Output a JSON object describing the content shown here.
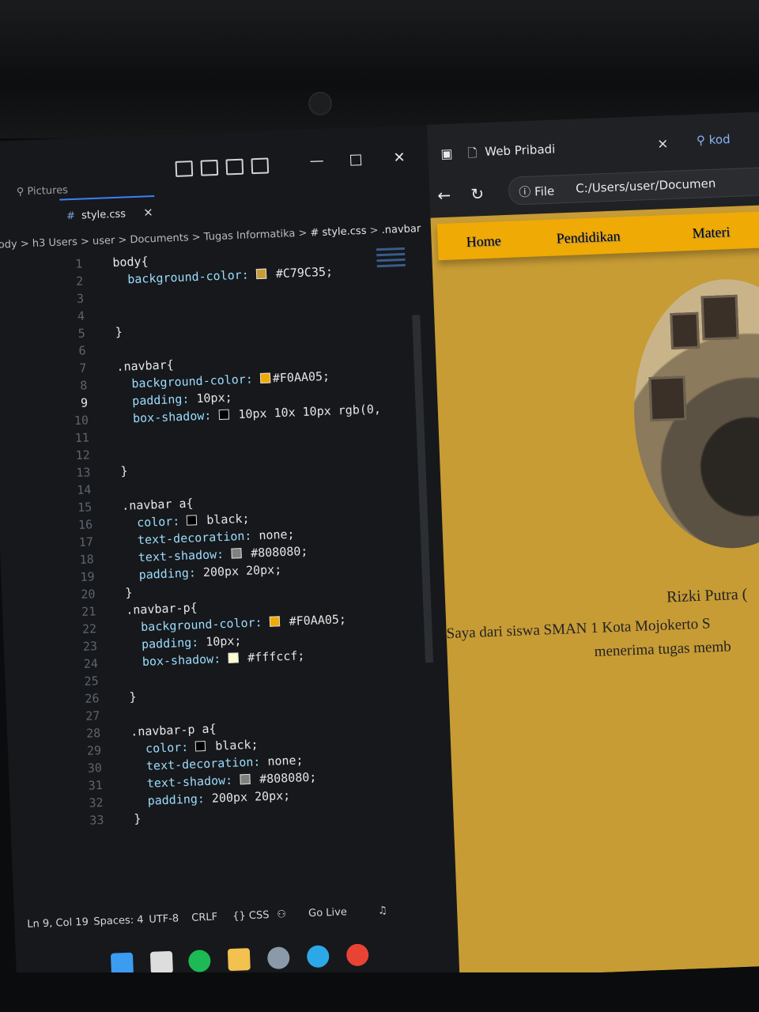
{
  "vscode": {
    "explorer_label": "Pictures",
    "tab": {
      "hash": "#",
      "label": "style.css",
      "close": "×"
    },
    "breadcrumb": [
      ".body",
      "h3",
      "Users",
      "user",
      "Documents",
      "Tugas Informatika",
      "# style.css",
      ".navbar"
    ],
    "title_icons": [
      "layout-icon",
      "toggle-primary-sidebar-icon",
      "toggle-panel-icon",
      "toggle-secondary-sidebar-icon"
    ],
    "window_controls": {
      "minimize": "—",
      "maximize": "□",
      "close": "✕"
    },
    "code_lines": [
      {
        "n": "1",
        "indent": "  ",
        "sel": "body{",
        "prop": "",
        "val": "",
        "swatch": ""
      },
      {
        "n": "2",
        "indent": "    ",
        "sel": "",
        "prop": "background-color:",
        "val": " #C79C35;",
        "swatch": "#C79C35"
      },
      {
        "n": "3",
        "indent": "",
        "sel": "",
        "prop": "",
        "val": "",
        "swatch": ""
      },
      {
        "n": "4",
        "indent": "",
        "sel": "",
        "prop": "",
        "val": "",
        "swatch": ""
      },
      {
        "n": "5",
        "indent": "  ",
        "sel": "}",
        "prop": "",
        "val": "",
        "swatch": ""
      },
      {
        "n": "6",
        "indent": "",
        "sel": "",
        "prop": "",
        "val": "",
        "swatch": ""
      },
      {
        "n": "7",
        "indent": "  ",
        "sel": ".navbar{",
        "prop": "",
        "val": "",
        "swatch": ""
      },
      {
        "n": "8",
        "indent": "    ",
        "sel": "",
        "prop": "background-color:",
        "val": "#F0AA05;",
        "swatch": "#F0AA05"
      },
      {
        "n": "9",
        "indent": "    ",
        "sel": "",
        "prop": "padding:",
        "val": " 10px;",
        "swatch": ""
      },
      {
        "n": "10",
        "indent": "    ",
        "sel": "",
        "prop": "box-shadow:",
        "val": " 10px 10x 10px rgb(0, ",
        "swatch": "#000000"
      },
      {
        "n": "11",
        "indent": "",
        "sel": "",
        "prop": "",
        "val": "",
        "swatch": ""
      },
      {
        "n": "12",
        "indent": "",
        "sel": "",
        "prop": "",
        "val": "",
        "swatch": ""
      },
      {
        "n": "13",
        "indent": "  ",
        "sel": "}",
        "prop": "",
        "val": "",
        "swatch": ""
      },
      {
        "n": "14",
        "indent": "",
        "sel": "",
        "prop": "",
        "val": "",
        "swatch": ""
      },
      {
        "n": "15",
        "indent": "  ",
        "sel": ".navbar a{",
        "prop": "",
        "val": "",
        "swatch": ""
      },
      {
        "n": "16",
        "indent": "    ",
        "sel": "",
        "prop": "color:",
        "val": " black;",
        "swatch": "#000000"
      },
      {
        "n": "17",
        "indent": "    ",
        "sel": "",
        "prop": "text-decoration:",
        "val": " none;",
        "swatch": ""
      },
      {
        "n": "18",
        "indent": "    ",
        "sel": "",
        "prop": "text-shadow:",
        "val": " #808080;",
        "swatch": "#808080"
      },
      {
        "n": "19",
        "indent": "    ",
        "sel": "",
        "prop": "padding:",
        "val": " 200px 20px;",
        "swatch": ""
      },
      {
        "n": "20",
        "indent": "  ",
        "sel": "}",
        "prop": "",
        "val": "",
        "swatch": ""
      },
      {
        "n": "21",
        "indent": "  ",
        "sel": ".navbar-p{",
        "prop": "",
        "val": "",
        "swatch": ""
      },
      {
        "n": "22",
        "indent": "    ",
        "sel": "",
        "prop": "background-color:",
        "val": " #F0AA05;",
        "swatch": "#F0AA05"
      },
      {
        "n": "23",
        "indent": "    ",
        "sel": "",
        "prop": "padding:",
        "val": " 10px;",
        "swatch": ""
      },
      {
        "n": "24",
        "indent": "    ",
        "sel": "",
        "prop": "box-shadow:",
        "val": " #fffccf;",
        "swatch": "#fffccf"
      },
      {
        "n": "25",
        "indent": "",
        "sel": "",
        "prop": "",
        "val": "",
        "swatch": ""
      },
      {
        "n": "26",
        "indent": "  ",
        "sel": "}",
        "prop": "",
        "val": "",
        "swatch": ""
      },
      {
        "n": "27",
        "indent": "",
        "sel": "",
        "prop": "",
        "val": "",
        "swatch": ""
      },
      {
        "n": "28",
        "indent": "  ",
        "sel": ".navbar-p a{",
        "prop": "",
        "val": "",
        "swatch": ""
      },
      {
        "n": "29",
        "indent": "    ",
        "sel": "",
        "prop": "color:",
        "val": " black;",
        "swatch": "#000000"
      },
      {
        "n": "30",
        "indent": "    ",
        "sel": "",
        "prop": "text-decoration:",
        "val": " none;",
        "swatch": ""
      },
      {
        "n": "31",
        "indent": "    ",
        "sel": "",
        "prop": "text-shadow:",
        "val": " #808080;",
        "swatch": "#808080"
      },
      {
        "n": "32",
        "indent": "    ",
        "sel": "",
        "prop": "padding:",
        "val": " 200px 20px;",
        "swatch": ""
      },
      {
        "n": "33",
        "indent": "  ",
        "sel": "}",
        "prop": "",
        "val": "",
        "swatch": ""
      }
    ],
    "active_line": "9",
    "status": {
      "position": "Ln 9, Col 19",
      "spaces": "Spaces: 4",
      "encoding": "UTF-8",
      "eol": "CRLF",
      "language": "{} CSS",
      "live": "Go Live"
    }
  },
  "browser": {
    "tab_title": "Web Pribadi",
    "tab_close": "×",
    "search_text": "kod",
    "address_info": "File",
    "address_url": "C:/Users/user/Documen",
    "page": {
      "nav_links": [
        "Home",
        "Pendidikan",
        "Materi"
      ],
      "name": "Rizki Putra (",
      "desc_line1": "Saya dari siswa SMAN 1 Kota Mojokerto S",
      "desc_line2": "menerima tugas memb"
    }
  },
  "colors": {
    "body_bg": "#C79C35",
    "navbar_bg": "#F0AA05",
    "editor_bg": "#16181b"
  }
}
